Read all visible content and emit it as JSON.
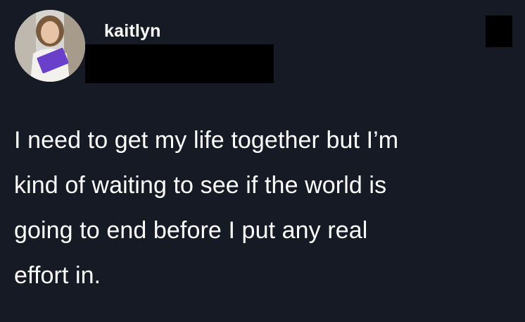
{
  "tweet": {
    "display_name": "kaitlyn",
    "text_lines": [
      "I need to get my life together but I’m",
      "kind of waiting to see if the world is",
      "going to end before I put any real",
      "effort in."
    ]
  },
  "icons": {
    "avatar": "profile-photo"
  },
  "colors": {
    "background": "#151a25",
    "text": "#ffffff",
    "redaction": "#000000"
  }
}
